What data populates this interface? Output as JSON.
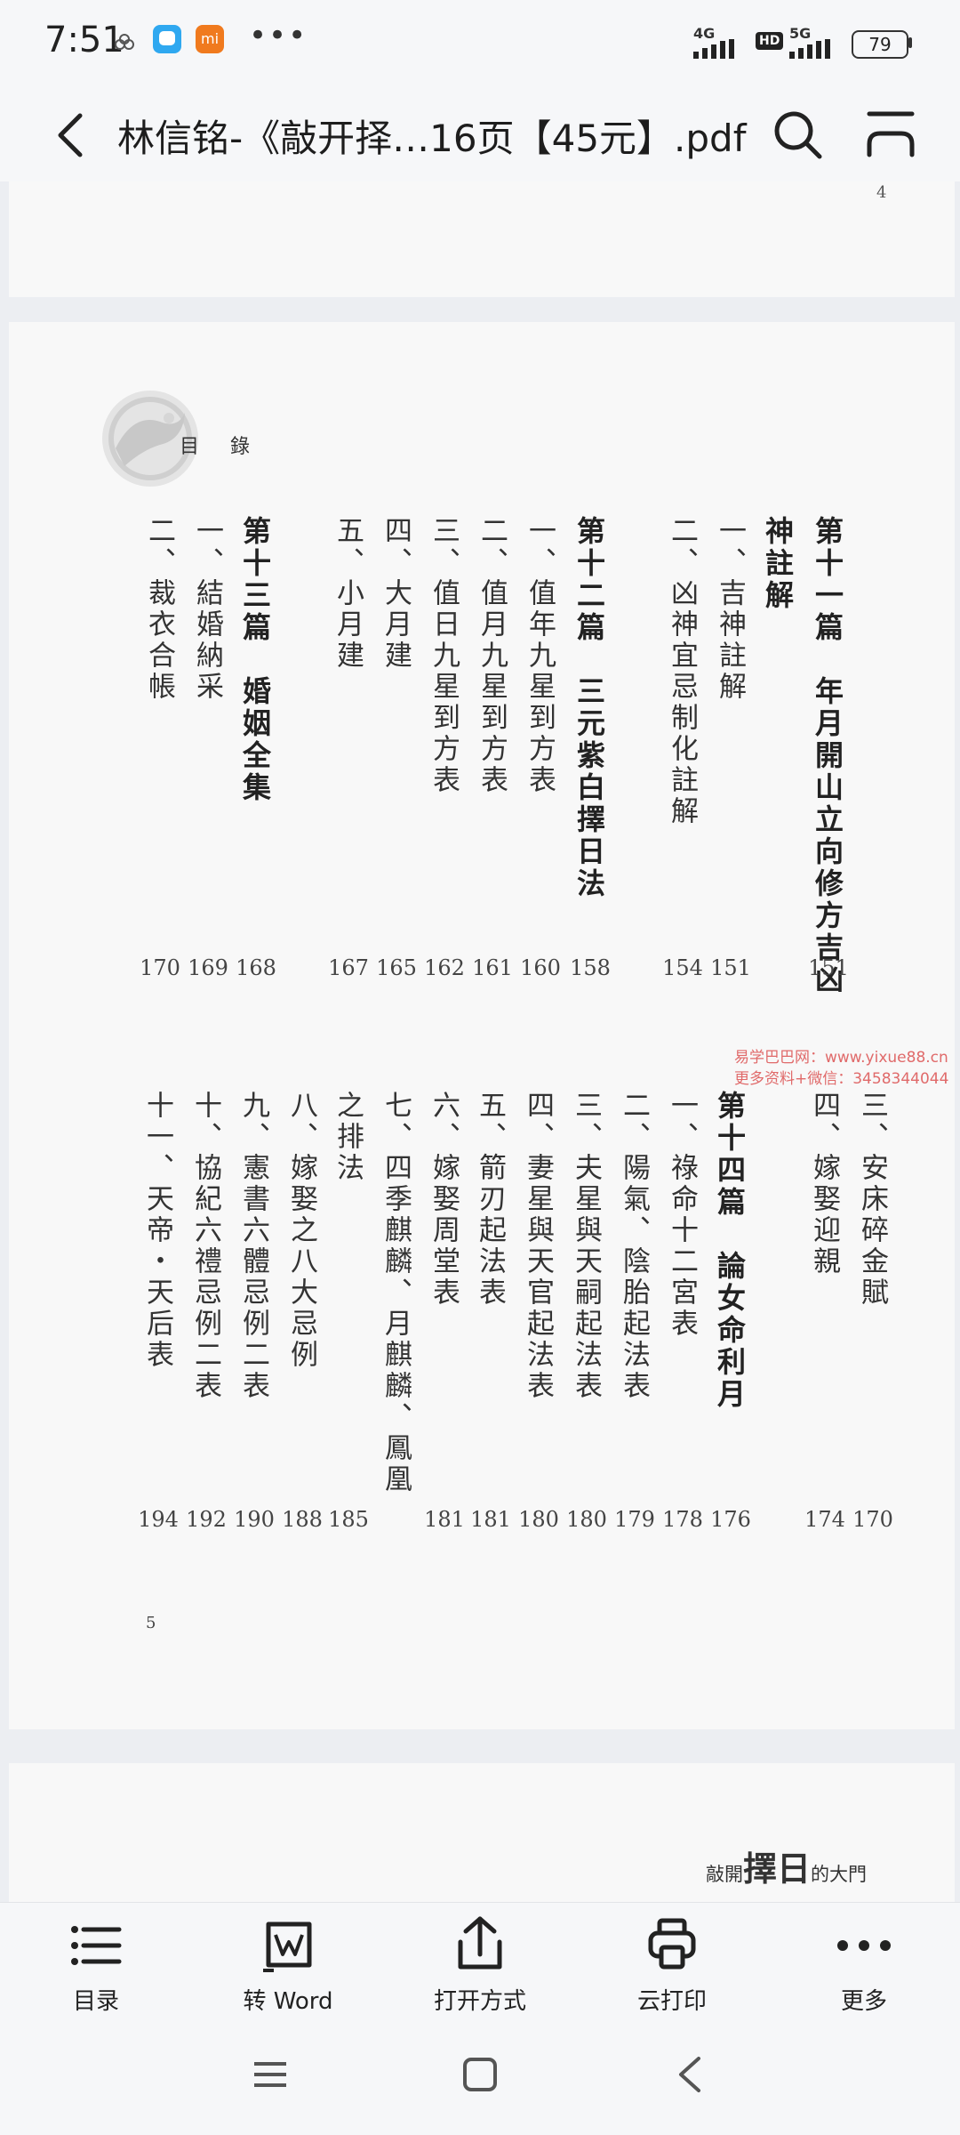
{
  "status_bar": {
    "time": "7:51",
    "network_1": "4G",
    "hd": "HD",
    "network_2": "5G",
    "battery": "79",
    "notification_icons": [
      "rings-icon",
      "chat-app-icon",
      "mi-app-icon",
      "more-dots-icon"
    ]
  },
  "title_bar": {
    "title": "林信铭-《敲开择…16页【45元】.pdf",
    "icons": [
      "back-arrow-icon",
      "search-icon",
      "menu-icon"
    ]
  },
  "document": {
    "page_prev_number": "4",
    "toc_header": "目 錄",
    "page_number": "5",
    "footer_pre": "敲開",
    "footer_big": "擇日",
    "footer_post": "的大門",
    "watermark_line1": "易学巴巴网：www.yixue88.cn",
    "watermark_line2": "更多资料+微信：3458344044",
    "upper_columns": [
      {
        "text": "第十一篇　年月開山立向修方吉凶",
        "page": "151",
        "head": true
      },
      {
        "text": "神註解",
        "page": "",
        "head": true
      },
      {
        "text": "一、吉神註解",
        "page": "151",
        "head": false
      },
      {
        "text": "二、凶神宜忌制化註解",
        "page": "154",
        "head": false
      },
      {
        "text": "第十二篇　三元紫白擇日法",
        "page": "158",
        "head": true
      },
      {
        "text": "一、值年九星到方表",
        "page": "160",
        "head": false
      },
      {
        "text": "二、值月九星到方表",
        "page": "161",
        "head": false
      },
      {
        "text": "三、值日九星到方表",
        "page": "162",
        "head": false
      },
      {
        "text": "四、大月建",
        "page": "165",
        "head": false
      },
      {
        "text": "五、小月建",
        "page": "167",
        "head": false
      },
      {
        "text": "第十三篇　婚姻全集",
        "page": "168",
        "head": true
      },
      {
        "text": "一、結婚納采",
        "page": "169",
        "head": false
      },
      {
        "text": "二、裁衣合帳",
        "page": "170",
        "head": false
      }
    ],
    "lower_columns": [
      {
        "text": "三、安床碎金賦",
        "page": "170",
        "head": false
      },
      {
        "text": "四、嫁娶迎親",
        "page": "174",
        "head": false
      },
      {
        "text": "第十四篇　論女命利月",
        "page": "176",
        "head": true
      },
      {
        "text": "一、祿命十二宮表",
        "page": "178",
        "head": false
      },
      {
        "text": "二、陽氣、陰胎起法表",
        "page": "179",
        "head": false
      },
      {
        "text": "三、夫星與天嗣起法表",
        "page": "180",
        "head": false
      },
      {
        "text": "四、妻星與天官起法表",
        "page": "180",
        "head": false
      },
      {
        "text": "五、箭刃起法表",
        "page": "181",
        "head": false
      },
      {
        "text": "六、嫁娶周堂表",
        "page": "181",
        "head": false
      },
      {
        "text": "七、四季麒麟、月麒麟、鳳凰",
        "page": "",
        "head": false
      },
      {
        "text": "之排法",
        "page": "185",
        "head": false
      },
      {
        "text": "八、嫁娶之八大忌例",
        "page": "188",
        "head": false
      },
      {
        "text": "九、憲書六體忌例二表",
        "page": "190",
        "head": false
      },
      {
        "text": "十、協紀六禮忌例二表",
        "page": "192",
        "head": false
      },
      {
        "text": "十一、天帝・天后表",
        "page": "194",
        "head": false
      }
    ]
  },
  "bottom_toolbar": [
    {
      "label": "目录",
      "icon": "list-icon"
    },
    {
      "label": "转 Word",
      "icon": "word-convert-icon"
    },
    {
      "label": "打开方式",
      "icon": "share-icon"
    },
    {
      "label": "云打印",
      "icon": "printer-icon"
    },
    {
      "label": "更多",
      "icon": "more-icon"
    }
  ],
  "nav_bar": [
    "recent-apps-icon",
    "home-icon",
    "back-icon"
  ]
}
